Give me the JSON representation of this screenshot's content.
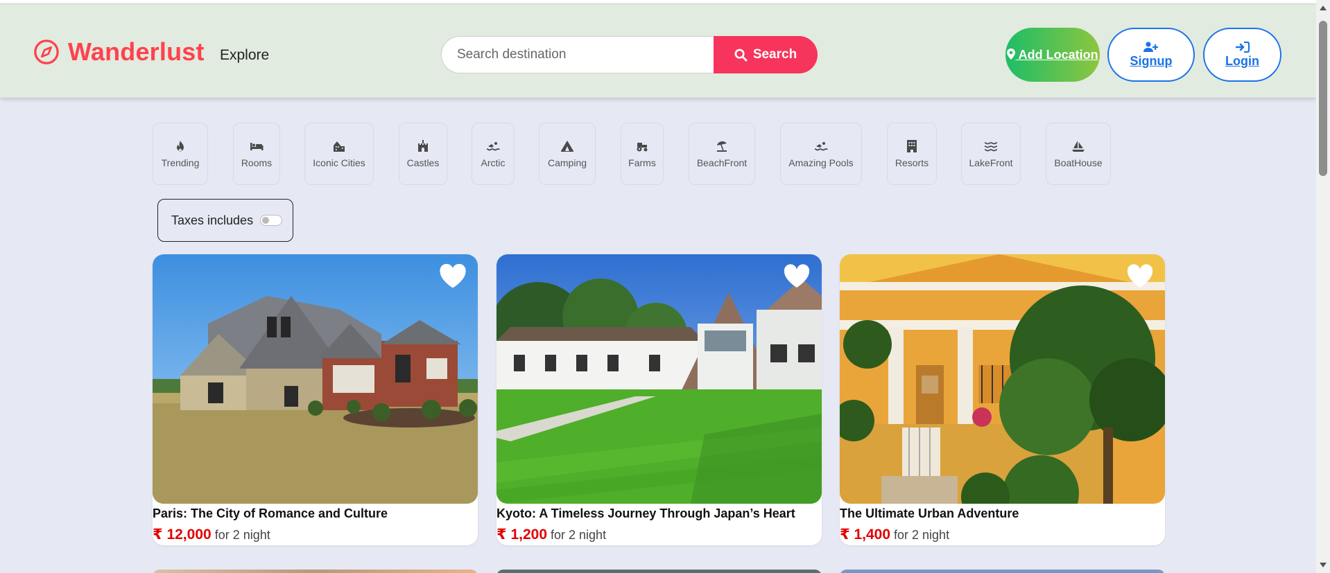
{
  "brand": {
    "name": "Wanderlust",
    "icon": "compass-icon",
    "color": "#fe424d"
  },
  "nav": {
    "explore": "Explore"
  },
  "search": {
    "placeholder": "Search destination",
    "button_label": "Search"
  },
  "actions": {
    "add_location": "Add Location",
    "signup": "Signup",
    "login": "Login"
  },
  "filters": [
    {
      "label": "Trending",
      "icon": "fire-icon"
    },
    {
      "label": "Rooms",
      "icon": "bed-icon"
    },
    {
      "label": "Iconic Cities",
      "icon": "city-icon"
    },
    {
      "label": "Castles",
      "icon": "castle-icon"
    },
    {
      "label": "Arctic",
      "icon": "swimmer-icon"
    },
    {
      "label": "Camping",
      "icon": "tent-icon"
    },
    {
      "label": "Farms",
      "icon": "tractor-icon"
    },
    {
      "label": "BeachFront",
      "icon": "umbrella-beach-icon"
    },
    {
      "label": "Amazing Pools",
      "icon": "pool-icon"
    },
    {
      "label": "Resorts",
      "icon": "building-icon"
    },
    {
      "label": "LakeFront",
      "icon": "water-icon"
    },
    {
      "label": "BoatHouse",
      "icon": "sailboat-icon"
    }
  ],
  "tax_toggle": {
    "label": "Taxes includes",
    "enabled": false
  },
  "listings": [
    {
      "title": "Paris: The City of Romance and Culture",
      "price": "₹ 12,000",
      "suffix": "for 2 night"
    },
    {
      "title": "Kyoto: A Timeless Journey Through Japan’s Heart",
      "price": "₹ 1,200",
      "suffix": "for 2 night"
    },
    {
      "title": "The Ultimate Urban Adventure",
      "price": "₹ 1,400",
      "suffix": "for 2 night"
    }
  ],
  "colors": {
    "accent": "#fe424d",
    "search_button": "#f7345b",
    "price": "#e10000",
    "link_blue": "#1a73e8",
    "navbar_bg": "#e2ebdf",
    "page_bg": "#e6e9f4"
  }
}
